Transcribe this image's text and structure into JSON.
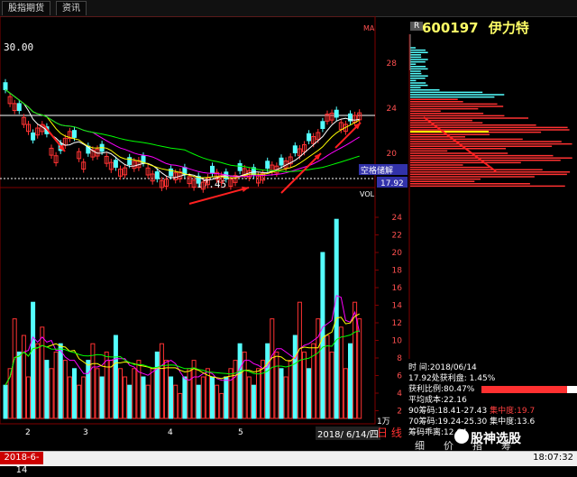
{
  "tabs": [
    "股指期货",
    "资讯"
  ],
  "stock": {
    "code": "600197",
    "name": "伊力特"
  },
  "r_badge": "R",
  "price_markers": {
    "high": "30.00",
    "low": "17.45"
  },
  "price_axis": [
    "28",
    "24",
    "20"
  ],
  "vol_axis": [
    "24",
    "22",
    "20",
    "18",
    "16",
    "14",
    "12",
    "10",
    "8",
    "6",
    "4",
    "2"
  ],
  "vol_label": "VOL",
  "vol_unit": "1万",
  "price_right_label": "17.92",
  "popup_label": "空格储解",
  "ma_label": "MA",
  "x_labels": [
    "2",
    "3",
    "4",
    "5"
  ],
  "date_range": "2018/ 6/14/四",
  "day_label": "日 线",
  "info": {
    "time": "时     间:2018/06/14",
    "profit": "17.92处获利盘: 1.45%",
    "ratio": "获利比例:80.47%",
    "avgcost": "平均成本:22.16",
    "chip90": "90筹码:18.41-27.43",
    "conc90": "集中度:19.7",
    "chip70": "70筹码:19.24-25.30",
    "conc70": "集中度:13.6",
    "extra": "筹码乖离:12.64"
  },
  "bottom_tabs": [
    "细",
    "价",
    "指",
    "筹"
  ],
  "watermark": "股神选股",
  "status": {
    "date": "2018-6-14",
    "time": "18:07:32"
  },
  "colors": {
    "up": "#ff3232",
    "down": "#54ffff",
    "bg": "#000000"
  },
  "chart_data": {
    "type": "bar",
    "title": "",
    "price_candles_description": "K-line daily chart",
    "volume": [
      4,
      6,
      12,
      8,
      10,
      5,
      14,
      9,
      11,
      7,
      6,
      8,
      9,
      7,
      5,
      6,
      4,
      5,
      7,
      9,
      6,
      5,
      8,
      7,
      10,
      6,
      5,
      4,
      6,
      7,
      5,
      4,
      6,
      8,
      9,
      7,
      5,
      4,
      3,
      5,
      6,
      7,
      4,
      5,
      6,
      5,
      4,
      3,
      5,
      6,
      7,
      9,
      8,
      5,
      4,
      6,
      7,
      9,
      12,
      8,
      6,
      5,
      7,
      10,
      14,
      8,
      6,
      9,
      12,
      20,
      10,
      8,
      24,
      11,
      6,
      9,
      14,
      12
    ],
    "ylim": [
      0,
      25
    ],
    "xlabel": "",
    "ylabel": ""
  }
}
